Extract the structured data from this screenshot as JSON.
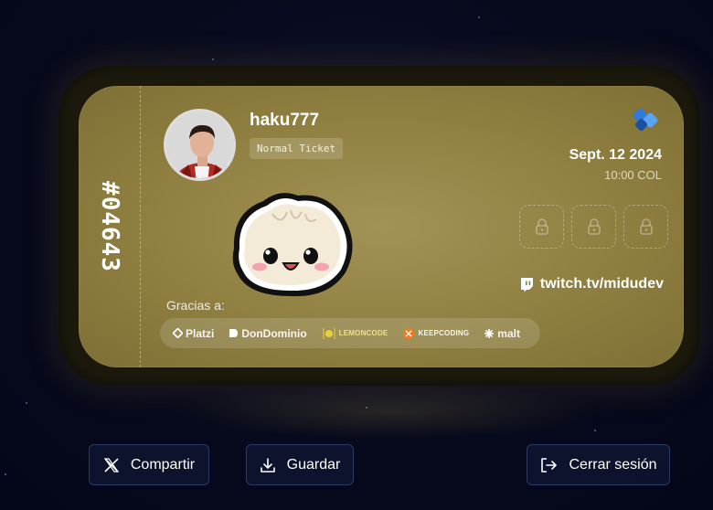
{
  "ticket": {
    "number": "#04643",
    "username": "haku777",
    "type": "Normal Ticket",
    "date": "Sept. 12 2024",
    "time": "10:00 COL",
    "twitch": "twitch.tv/midudev",
    "thanks_label": "Gracias a:",
    "sticker_slots": [
      {
        "icon": "lock-icon"
      },
      {
        "icon": "lock-icon"
      },
      {
        "icon": "lock-icon"
      }
    ],
    "sponsors": [
      {
        "name": "Platzi"
      },
      {
        "name": "DonDominio"
      },
      {
        "name": "LEMONCODE"
      },
      {
        "name": "KEEPCODING"
      },
      {
        "name": "malt"
      }
    ]
  },
  "actions": {
    "share_label": "Compartir",
    "save_label": "Guardar",
    "logout_label": "Cerrar sesión"
  },
  "colors": {
    "ticket": "#8f7f40",
    "background": "#070a1c",
    "button_border": "#2b3a66",
    "brand_blue": "#2f7bd8"
  }
}
